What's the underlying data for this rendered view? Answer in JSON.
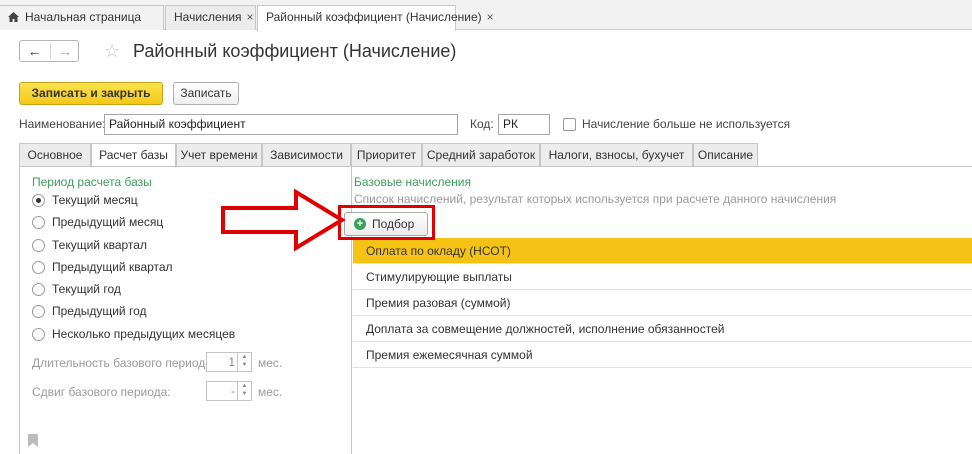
{
  "tabs": {
    "home": "Начальная страница",
    "items": [
      {
        "label": "Начисления",
        "close": "×"
      },
      {
        "label": "Районный коэффициент (Начисление)",
        "close": "×"
      }
    ]
  },
  "header": {
    "back": "←",
    "forward": "→",
    "star": "☆",
    "title": "Районный коэффициент (Начисление)"
  },
  "toolbar": {
    "save_close_label": "Записать и закрыть",
    "save_label": "Записать"
  },
  "form": {
    "name_label": "Наименование:",
    "name_value": "Районный коэффициент",
    "code_label": "Код:",
    "code_value": "РК",
    "unused_label": "Начисление больше не используется"
  },
  "form_tabs": [
    "Основное",
    "Расчет базы",
    "Учет времени",
    "Зависимости",
    "Приоритет",
    "Средний заработок",
    "Налоги, взносы, бухучет",
    "Описание"
  ],
  "base_period": {
    "title": "Период расчета базы",
    "options": [
      "Текущий месяц",
      "Предыдущий месяц",
      "Текущий квартал",
      "Предыдущий квартал",
      "Текущий год",
      "Предыдущий год",
      "Несколько предыдущих месяцев"
    ],
    "selected_index": 0,
    "duration_label": "Длительность базового периода:",
    "duration_value": "1",
    "duration_unit": "мес.",
    "shift_label": "Сдвиг базового периода:",
    "shift_value": "-",
    "shift_unit": "мес."
  },
  "base_accruals": {
    "title": "Базовые начисления",
    "hint": "Список начислений, результат которых используется при расчете данного начисления",
    "pick_button": "Подбор",
    "rows": [
      "Оплата по окладу (НСОТ)",
      "Стимулирующие выплаты",
      "Премия разовая (суммой)",
      "Доплата за совмещение должностей, исполнение обязанностей",
      "Премия ежемесячная суммой"
    ],
    "selected_index": 0
  },
  "colors": {
    "accent": "#f5c315",
    "group_title": "#3aa05a",
    "annotation": "#e00000"
  }
}
